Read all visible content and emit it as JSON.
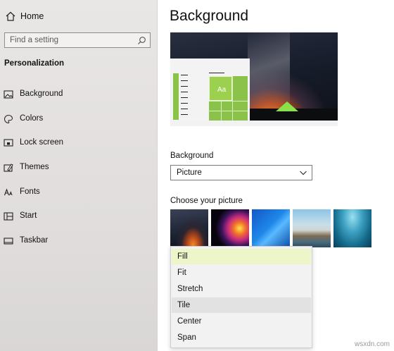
{
  "sidebar": {
    "home_label": "Home",
    "search_placeholder": "Find a setting",
    "section_title": "Personalization",
    "items": [
      {
        "label": "Background",
        "icon": "picture-icon"
      },
      {
        "label": "Colors",
        "icon": "palette-icon"
      },
      {
        "label": "Lock screen",
        "icon": "lock-screen-icon"
      },
      {
        "label": "Themes",
        "icon": "themes-icon"
      },
      {
        "label": "Fonts",
        "icon": "fonts-icon"
      },
      {
        "label": "Start",
        "icon": "start-icon"
      },
      {
        "label": "Taskbar",
        "icon": "taskbar-icon"
      }
    ]
  },
  "main": {
    "title": "Background",
    "preview": {
      "tile_label": "Aa"
    },
    "background_label": "Background",
    "background_value": "Picture",
    "choose_label": "Choose your picture",
    "fit_options": [
      "Fill",
      "Fit",
      "Stretch",
      "Tile",
      "Center",
      "Span"
    ],
    "fit_selected": "Fill",
    "fit_hovered": "Tile"
  },
  "watermark": "wsxdn.com",
  "colors": {
    "accent": "#8bc34a",
    "selected_bg": "#ecf6c9"
  }
}
